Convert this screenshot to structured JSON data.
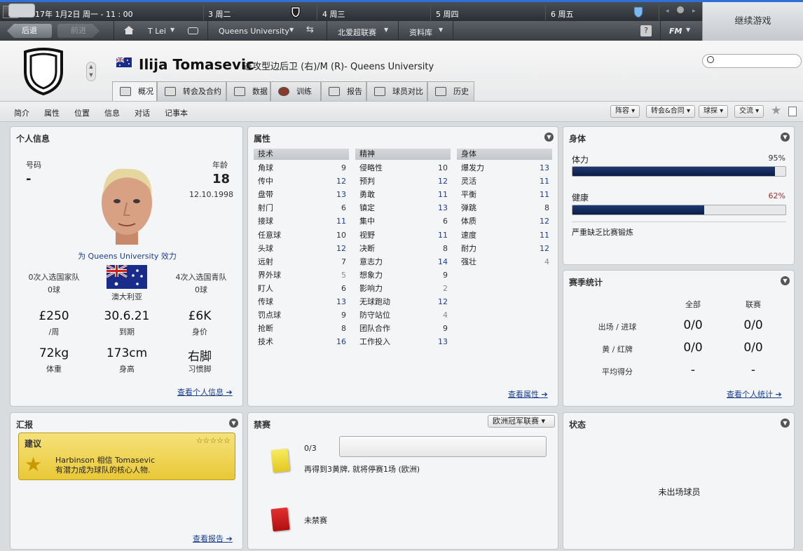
{
  "topbar": {
    "date": "2017年 1月2日   周一 -  11 : 00",
    "days": [
      "3 周二",
      "4 周三",
      "5 周四",
      "6 周五"
    ]
  },
  "nav": {
    "back": "后退",
    "forward": "前进",
    "user": "T Lei",
    "club": "Queens University",
    "league": "北爱超联赛",
    "database": "资料库",
    "help": "?",
    "fm": "FM",
    "continue": "继续游戏"
  },
  "player": {
    "name": "Ilija Tomasevic",
    "position": "进攻型边后卫 (右)/M (R)- Queens University"
  },
  "tabs": [
    "概况",
    "转会及合约",
    "数据",
    "训练",
    "报告",
    "球员对比",
    "历史"
  ],
  "subnav": {
    "items": [
      "简介",
      "属性",
      "位置",
      "信息",
      "对话",
      "记事本"
    ],
    "drops": [
      "阵容",
      "转会&合同",
      "球探",
      "交流"
    ]
  },
  "personal": {
    "title": "个人信息",
    "number_label": "号码",
    "number": "-",
    "age_label": "年龄",
    "age": "18",
    "dob": "12.10.1998",
    "plays_for": "为 Queens University 效力",
    "senior_caps": "0次入选国家队",
    "senior_goals": "0球",
    "nation": "澳大利亚",
    "youth_caps": "4次入选国青队",
    "youth_goals": "0球",
    "wage": "£250",
    "wage_label": "/周",
    "expires": "30.6.21",
    "expires_label": "到期",
    "value": "£6K",
    "value_label": "身价",
    "weight": "72kg",
    "weight_label": "体重",
    "height": "173cm",
    "height_label": "身高",
    "foot": "右脚",
    "foot_label": "习惯脚",
    "link": "查看个人信息"
  },
  "attributes": {
    "title": "属性",
    "technical_title": "技术",
    "mental_title": "精神",
    "physical_title": "身体",
    "technical": [
      {
        "n": "角球",
        "v": "9"
      },
      {
        "n": "传中",
        "v": "12"
      },
      {
        "n": "盘带",
        "v": "13"
      },
      {
        "n": "射门",
        "v": "6"
      },
      {
        "n": "接球",
        "v": "11"
      },
      {
        "n": "任意球",
        "v": "10"
      },
      {
        "n": "头球",
        "v": "12"
      },
      {
        "n": "远射",
        "v": "7"
      },
      {
        "n": "界外球",
        "v": "5"
      },
      {
        "n": "盯人",
        "v": "6"
      },
      {
        "n": "传球",
        "v": "13"
      },
      {
        "n": "罚点球",
        "v": "9"
      },
      {
        "n": "抢断",
        "v": "8"
      },
      {
        "n": "技术",
        "v": "16"
      }
    ],
    "mental": [
      {
        "n": "侵略性",
        "v": "10"
      },
      {
        "n": "预判",
        "v": "12"
      },
      {
        "n": "勇敢",
        "v": "11"
      },
      {
        "n": "镇定",
        "v": "13"
      },
      {
        "n": "集中",
        "v": "6"
      },
      {
        "n": "视野",
        "v": "11"
      },
      {
        "n": "决断",
        "v": "8"
      },
      {
        "n": "意志力",
        "v": "14"
      },
      {
        "n": "想象力",
        "v": "9"
      },
      {
        "n": "影响力",
        "v": "2"
      },
      {
        "n": "无球跑动",
        "v": "12"
      },
      {
        "n": "防守站位",
        "v": "4"
      },
      {
        "n": "团队合作",
        "v": "9"
      },
      {
        "n": "工作投入",
        "v": "13"
      }
    ],
    "physical": [
      {
        "n": "爆发力",
        "v": "13"
      },
      {
        "n": "灵活",
        "v": "11"
      },
      {
        "n": "平衡",
        "v": "11"
      },
      {
        "n": "弹跳",
        "v": "8"
      },
      {
        "n": "体质",
        "v": "12"
      },
      {
        "n": "速度",
        "v": "11"
      },
      {
        "n": "耐力",
        "v": "12"
      },
      {
        "n": "强壮",
        "v": "4"
      }
    ],
    "link": "查看属性"
  },
  "body": {
    "title": "身体",
    "stamina_label": "体力",
    "stamina": "95%",
    "stamina_fraction": 0.95,
    "health_label": "健康",
    "health": "62%",
    "health_fraction": 0.62,
    "note": "严重缺乏比赛锻炼"
  },
  "season": {
    "title": "赛季统计",
    "col_all": "全部",
    "col_league": "联赛",
    "rows": [
      {
        "label": "出场 / 进球",
        "all": "0/0",
        "league": "0/0"
      },
      {
        "label": "黄 / 红牌",
        "all": "0/0",
        "league": "0/0"
      },
      {
        "label": "平均得分",
        "all": "-",
        "league": "-"
      }
    ],
    "link": "查看个人统计"
  },
  "report": {
    "title": "汇报",
    "card_title": "建议",
    "stars": "☆☆☆☆☆",
    "line1": "Harbinson 相信 Tomasevic",
    "line2": "有潜力成为球队的核心人物.",
    "link": "查看报告"
  },
  "bans": {
    "title": "禁赛",
    "competition": "欧洲冠军联赛",
    "yellow_count": "0/3",
    "yellow_note": "再得到3黄牌, 就将停赛1场 (欧洲)",
    "red_note": "未禁赛"
  },
  "status": {
    "title": "状态",
    "text": "未出场球员"
  },
  "colors": {
    "accent": "#2f6fd8",
    "bar": "#0b1d45",
    "high_attr": "#1f3b8f",
    "health_pct": "#a0302b"
  }
}
